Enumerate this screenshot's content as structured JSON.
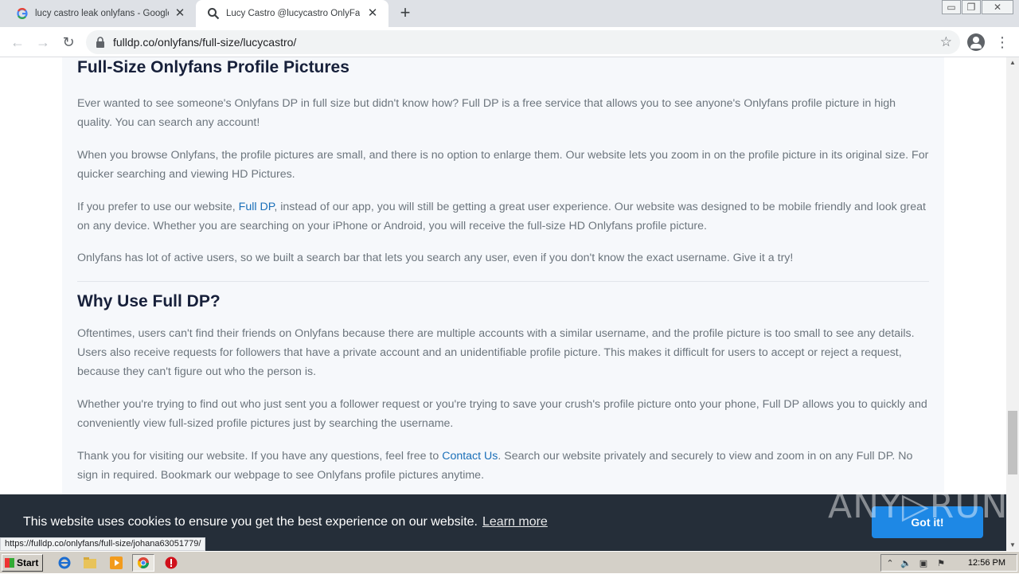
{
  "tabs": [
    {
      "title": "lucy castro leak onlyfans - Google Se",
      "icon": "google-icon"
    },
    {
      "title": "Lucy Castro @lucycastro OnlyFans F",
      "icon": "search-icon"
    }
  ],
  "window_controls": {
    "minimize": "▭",
    "restore": "❐",
    "close": "✕"
  },
  "toolbar": {
    "url": "fulldp.co/onlyfans/full-size/lucycastro/"
  },
  "content": {
    "heading1": "Full-Size Onlyfans Profile Pictures",
    "p1": "Ever wanted to see someone's Onlyfans DP in full size but didn't know how? Full DP is a free service that allows you to see anyone's Onlyfans profile picture in high quality. You can search any account!",
    "p2": "When you browse Onlyfans, the profile pictures are small, and there is no option to enlarge them. Our website lets you zoom in on the profile picture in its original size. For quicker searching and viewing HD Pictures.",
    "p3_before": "If you prefer to use our website, ",
    "p3_link": "Full DP",
    "p3_after": ", instead of our app, you will still be getting a great user experience. Our website was designed to be mobile friendly and look great on any device. Whether you are searching on your iPhone or Android, you will receive the full-size HD Onlyfans profile picture.",
    "p4": "Onlyfans has lot of active users, so we built a search bar that lets you search any user, even if you don't know the exact username. Give it a try!",
    "heading2": "Why Use Full DP?",
    "p5": "Oftentimes, users can't find their friends on Onlyfans because there are multiple accounts with a similar username, and the profile picture is too small to see any details. Users also receive requests for followers that have a private account and an unidentifiable profile picture. This makes it difficult for users to accept or reject a request, because they can't figure out who the person is.",
    "p6": "Whether you're trying to find out who just sent you a follower request or you're trying to save your crush's profile picture onto your phone, Full DP allows you to quickly and conveniently view full-sized profile pictures just by searching the username.",
    "p7_before": "Thank you for visiting our website. If you have any questions, feel free to ",
    "p7_link": "Contact Us",
    "p7_after": ". Search our website privately and securely to view and zoom in on any Full DP. No sign in required. Bookmark our webpage to see Onlyfans profile pictures anytime."
  },
  "cookie": {
    "message": "This website uses cookies to ensure you get the best experience on our website.",
    "learn_more": "Learn more",
    "button": "Got it!"
  },
  "watermark": "ANY▷RUN",
  "status_url": "https://fulldp.co/onlyfans/full-size/johana63051779/",
  "taskbar": {
    "start": "Start",
    "clock": "12:56 PM"
  },
  "colors": {
    "link": "#1a6fb8",
    "cookie_bg": "#252e39",
    "button": "#1e88e5",
    "heading": "#17203a",
    "body_text": "#6c757d"
  }
}
